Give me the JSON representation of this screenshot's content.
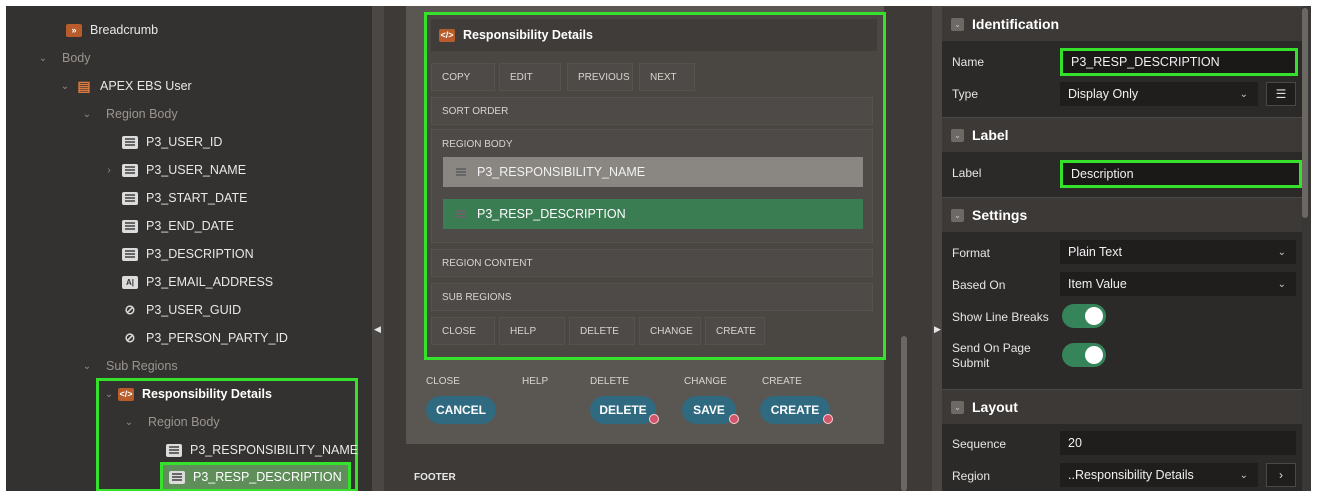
{
  "tree": {
    "breadcrumb": "Breadcrumb",
    "body": "Body",
    "apex_ebs_user": "APEX EBS User",
    "region_body": "Region Body",
    "items": [
      "P3_USER_ID",
      "P3_USER_NAME",
      "P3_START_DATE",
      "P3_END_DATE",
      "P3_DESCRIPTION",
      "P3_EMAIL_ADDRESS",
      "P3_USER_GUID",
      "P3_PERSON_PARTY_ID"
    ],
    "sub_regions": "Sub Regions",
    "resp_details": "Responsibility Details",
    "sub_region_body": "Region Body",
    "sub_items": [
      "P3_RESPONSIBILITY_NAME",
      "P3_RESP_DESCRIPTION"
    ]
  },
  "canvas": {
    "region_title": "Responsibility Details",
    "top_slots": [
      "COPY",
      "EDIT",
      "PREVIOUS",
      "NEXT"
    ],
    "sort_order": "SORT ORDER",
    "region_body": "REGION BODY",
    "item1": "P3_RESPONSIBILITY_NAME",
    "item2": "P3_RESP_DESCRIPTION",
    "region_content": "REGION CONTENT",
    "sub_regions": "SUB REGIONS",
    "bottom_slots": [
      "CLOSE",
      "HELP",
      "DELETE",
      "CHANGE",
      "CREATE"
    ],
    "outer_slots": [
      "CLOSE",
      "HELP",
      "DELETE",
      "CHANGE",
      "CREATE"
    ],
    "buttons": {
      "cancel": "CANCEL",
      "delete": "DELETE",
      "save": "SAVE",
      "create": "CREATE"
    },
    "footer": "FOOTER"
  },
  "props": {
    "identification": "Identification",
    "name_label": "Name",
    "name_value": "P3_RESP_DESCRIPTION",
    "type_label": "Type",
    "type_value": "Display Only",
    "label_section": "Label",
    "label_label": "Label",
    "label_value": "Description",
    "settings": "Settings",
    "format_label": "Format",
    "format_value": "Plain Text",
    "based_on_label": "Based On",
    "based_on_value": "Item Value",
    "show_line_breaks": "Show Line Breaks",
    "send_on_submit": "Send On Page Submit",
    "layout": "Layout",
    "sequence_label": "Sequence",
    "sequence_value": "20",
    "region_label": "Region",
    "region_value": "..Responsibility Details"
  },
  "colors": {
    "highlight": "#35e12a",
    "toggle_on": "#36845a",
    "button": "#2f6a80"
  }
}
